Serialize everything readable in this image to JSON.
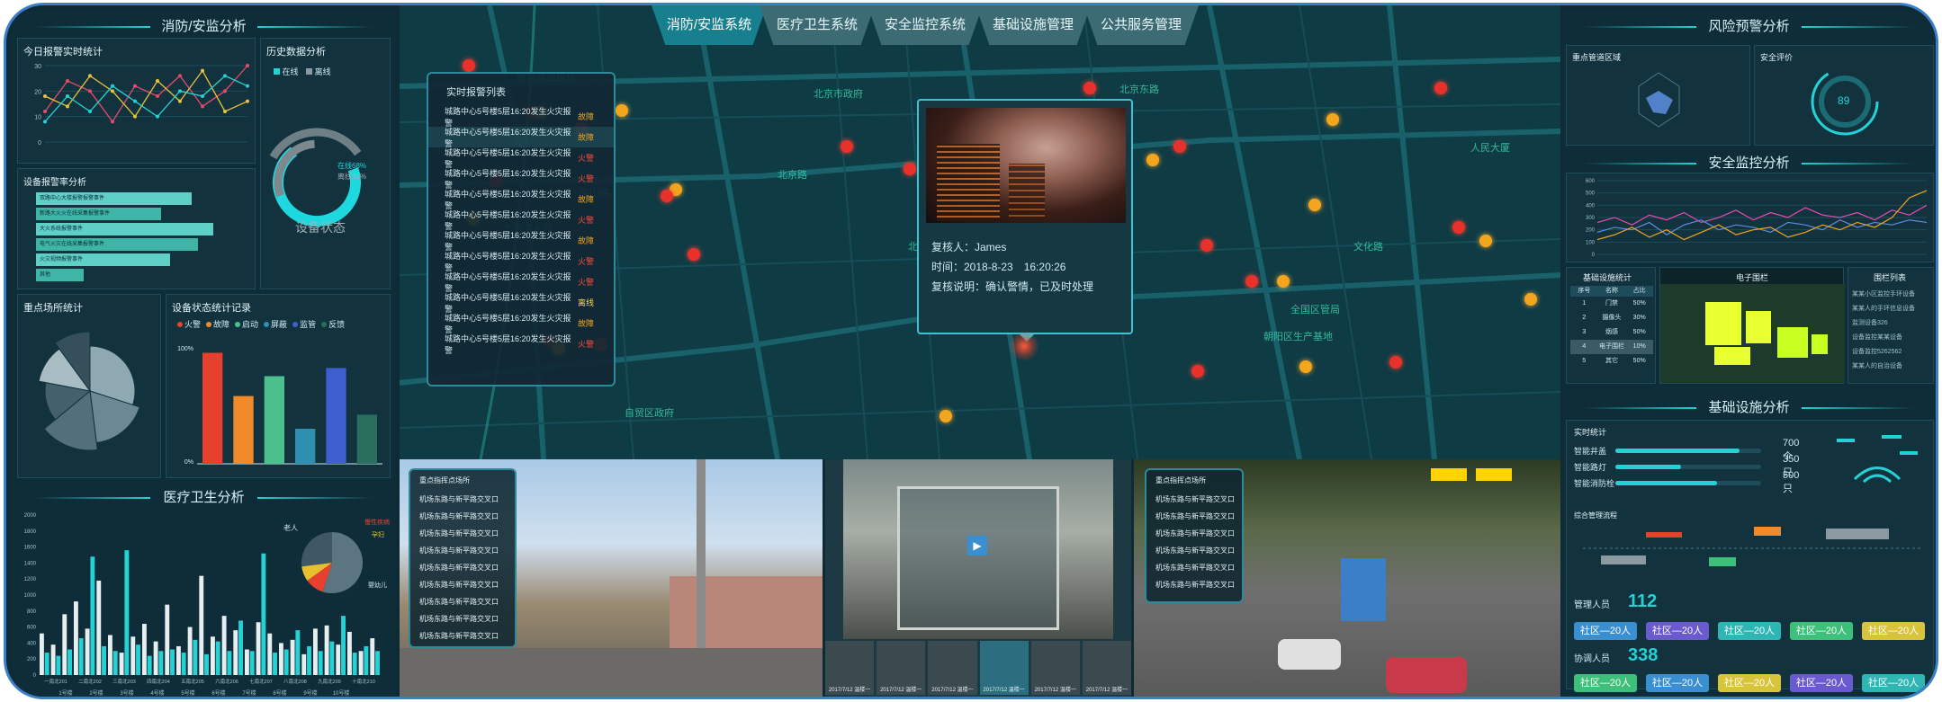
{
  "top_tabs": [
    "消防/安监系统",
    "医疗卫生系统",
    "安全监控系统",
    "基础设施管理",
    "公共服务管理"
  ],
  "left": {
    "section_title": "消防/安监分析",
    "today_alarm": {
      "title": "今日报警实时统计",
      "yticks": [
        "30",
        "20",
        "10",
        "0"
      ]
    },
    "history": {
      "title": "历史数据分析",
      "legend": [
        "在线",
        "离线"
      ],
      "online": "在线68%",
      "offline": "离线32%",
      "center": "设备状态",
      "online_pct": 68
    },
    "alarm_rate": {
      "title": "设备报警率分析",
      "bars": [
        {
          "label": "双路中心大楼报警报警事件",
          "v": 0.72
        },
        {
          "label": "新路大火火在线采集报警事件",
          "v": 0.58
        },
        {
          "label": "大火系统报警事件",
          "v": 0.82
        },
        {
          "label": "电气火灾在线采集报警事件",
          "v": 0.75
        },
        {
          "label": "火灾视频报警事件",
          "v": 0.62
        },
        {
          "label": "其他",
          "v": 0.22
        }
      ]
    },
    "area": {
      "title": "重点场所统计"
    },
    "device_status": {
      "title": "设备状态统计记录",
      "legend": [
        "火警",
        "故障",
        "启动",
        "屏蔽",
        "监管",
        "反馈"
      ],
      "colors": [
        "#e8402f",
        "#f08a2b",
        "#4bbf8e",
        "#2e8fb0",
        "#3f5fd0",
        "#2a6e5d"
      ],
      "values": [
        95,
        58,
        75,
        30,
        82,
        42
      ],
      "yticks": [
        "100%",
        "0%"
      ]
    }
  },
  "medical": {
    "title": "医疗卫生分析",
    "yticks": [
      "2000",
      "1800",
      "1600",
      "1400",
      "1200",
      "1000",
      "800",
      "600",
      "400",
      "200",
      "0"
    ],
    "xlabels": [
      "一南北201",
      "二南北202",
      "三南北203",
      "四南北204",
      "五南北205",
      "六南北206",
      "七南北207",
      "八南北208",
      "九南北209",
      "十南北210"
    ],
    "months": [
      "1号楼",
      "2号楼",
      "3号楼",
      "4号楼",
      "5号楼",
      "6号楼",
      "7号楼",
      "8号楼",
      "9号楼",
      "10号楼"
    ],
    "pie_labels": [
      "老人",
      "慢性疾病",
      "孕妇",
      "婴幼儿"
    ]
  },
  "alarm_list": {
    "title": "实时报警列表",
    "rows": [
      {
        "text": "城路中心5号楼5层16:20发生火灾报警",
        "status": "故障"
      },
      {
        "text": "城路中心5号楼5层16:20发生火灾报警",
        "status": "故障"
      },
      {
        "text": "城路中心5号楼5层16:20发生火灾报警",
        "status": "火警"
      },
      {
        "text": "城路中心5号楼5层16:20发生火灾报警",
        "status": "火警"
      },
      {
        "text": "城路中心5号楼5层16:20发生火灾报警",
        "status": "故障"
      },
      {
        "text": "城路中心5号楼5层16:20发生火灾报警",
        "status": "火警"
      },
      {
        "text": "城路中心5号楼5层16:20发生火灾报警",
        "status": "故障"
      },
      {
        "text": "城路中心5号楼5层16:20发生火灾报警",
        "status": "火警"
      },
      {
        "text": "城路中心5号楼5层16:20发生火灾报警",
        "status": "火警"
      },
      {
        "text": "城路中心5号楼5层16:20发生火灾报警",
        "status": "离线"
      },
      {
        "text": "城路中心5号楼5层16:20发生火灾报警",
        "status": "故障"
      },
      {
        "text": "城路中心5号楼5层16:20发生火灾报警",
        "status": "火警"
      }
    ]
  },
  "popup": {
    "reviewer": "复核人：James",
    "time": "时间：2018-8-23　16:20:26",
    "note": "复核说明：确认警情，已及时处理"
  },
  "map_labels": [
    "南京路正纵场",
    "北京市政府",
    "中山路",
    "北京工业园",
    "北京工厂",
    "北京东路",
    "朝阳区生产基地",
    "全国区管局",
    "自贸区政府",
    "人民大厦",
    "文化路",
    "北京路"
  ],
  "cam": {
    "list_title": "重点指挥点场所",
    "rows": [
      "机场东路与新平路交叉口",
      "机场东路与新平路交叉口",
      "机场东路与新平路交叉口",
      "机场东路与新平路交叉口",
      "机场东路与新平路交叉口",
      "机场东路与新平路交叉口",
      "机场东路与新平路交叉口",
      "机场东路与新平路交叉口",
      "机场东路与新平路交叉口"
    ],
    "list_title2": "重点指挥点场所",
    "rows2": [
      "机场东路与新平路交叉口",
      "机场东路与新平路交叉口",
      "机场东路与新平路交叉口",
      "机场东路与新平路交叉口",
      "机场东路与新平路交叉口",
      "机场东路与新平路交叉口"
    ],
    "thumbs": [
      "2017/7/12 温楼一",
      "2017/7/12 温楼一",
      "2017/7/12 温楼一",
      "2017/7/12 温楼一",
      "2017/7/12 温楼一",
      "2017/7/12 温楼一"
    ]
  },
  "right": {
    "risk_title": "风险预警分析",
    "area_title": "重点管道区域",
    "safety_title": "安全评价",
    "safety_value": "89",
    "monitor_title": "安全监控分析",
    "monitor_yticks": [
      "600",
      "500",
      "400",
      "300",
      "200",
      "100",
      "0"
    ],
    "infra_stat": {
      "title": "基础设施统计",
      "headers": [
        "序号",
        "名称",
        "占比"
      ],
      "rows": [
        [
          "1",
          "门禁",
          "50%"
        ],
        [
          "2",
          "摄像头",
          "30%"
        ],
        [
          "3",
          "烟感",
          "50%"
        ],
        [
          "4",
          "电子围栏",
          "10%"
        ],
        [
          "5",
          "其它",
          "50%"
        ]
      ]
    },
    "fence_title": "电子围栏",
    "list_title": "围栏列表",
    "fence_items": [
      "某某小区监控手环设备",
      "某某人的手环信息设备",
      "监测设备326",
      "设备监控某某设备",
      "设备监控5262562",
      "某某人的自治设备"
    ],
    "infra_title": "基础设施分析",
    "realtime": {
      "title": "实时统计",
      "items": [
        {
          "label": "智能井盖",
          "value": "700个",
          "pct": 0.85
        },
        {
          "label": "智能路灯",
          "value": "350只",
          "pct": 0.45
        },
        {
          "label": "智能消防栓",
          "value": "500只",
          "pct": 0.7
        }
      ]
    },
    "mgmt_title": "综合管理流程",
    "managers": {
      "label": "管理人员",
      "count": "112",
      "buttons": [
        "社区—20人",
        "社区—20人",
        "社区—20人",
        "社区—20人",
        "社区—20人"
      ]
    },
    "coord": {
      "label": "协调人员",
      "count": "338",
      "buttons": [
        "社区—20人",
        "社区—20人",
        "社区—20人",
        "社区—20人",
        "社区—20人"
      ]
    },
    "btn_colors": [
      "#3a8fd0",
      "#6a5ad0",
      "#2eb6b4",
      "#3cc07a",
      "#d8c43a"
    ],
    "btn_colors2": [
      "#3cc07a",
      "#3a8fd0",
      "#d8c43a",
      "#6a5ad0",
      "#2eb6b4"
    ]
  },
  "chart_data": [
    {
      "type": "line",
      "title": "今日报警实时统计",
      "series": [
        {
          "values": [
            12,
            24,
            20,
            8,
            22,
            18,
            26,
            14,
            20,
            30
          ]
        },
        {
          "values": [
            18,
            14,
            26,
            20,
            10,
            24,
            16,
            28,
            12,
            16
          ]
        },
        {
          "values": [
            8,
            18,
            12,
            22,
            16,
            10,
            20,
            18,
            26,
            22
          ]
        }
      ],
      "ylim": [
        0,
        30
      ]
    },
    {
      "type": "bar",
      "title": "设备状态统计记录",
      "categories": [
        "火警",
        "故障",
        "启动",
        "屏蔽",
        "监管",
        "反馈"
      ],
      "values": [
        95,
        58,
        75,
        30,
        82,
        42
      ],
      "ylim": [
        0,
        100
      ]
    },
    {
      "type": "bar",
      "title": "医疗卫生分析",
      "series": [
        {
          "values": [
            520,
            380,
            760,
            920,
            580,
            1180,
            500,
            280,
            480,
            640,
            420,
            880,
            360,
            600,
            1240,
            480,
            740,
            560,
            320,
            660,
            520,
            400,
            440,
            260,
            580,
            620,
            380,
            540,
            300,
            460
          ]
        },
        {
          "values": [
            280,
            240,
            320,
            460,
            1480,
            360,
            300,
            1560,
            380,
            240,
            300,
            320,
            280,
            440,
            260,
            420,
            300,
            680,
            300,
            1520,
            280,
            320,
            560,
            360,
            300,
            420,
            740,
            280,
            360,
            300
          ]
        }
      ],
      "ylim": [
        0,
        2000
      ]
    },
    {
      "type": "pie",
      "title": "重点场所统计",
      "values": [
        30,
        18,
        16,
        14,
        12,
        10
      ]
    },
    {
      "type": "line",
      "title": "安全监控分析",
      "series": [
        {
          "values": [
            260,
            300,
            240,
            320,
            280,
            340,
            260,
            300,
            360,
            280,
            340,
            300,
            380,
            320,
            300,
            340,
            280,
            360,
            320,
            400
          ]
        },
        {
          "values": [
            180,
            220,
            200,
            260,
            160,
            240,
            280,
            200,
            240,
            220,
            180,
            260,
            240,
            200,
            280,
            220,
            260,
            240,
            280,
            260
          ]
        },
        {
          "values": [
            120,
            160,
            220,
            140,
            200,
            120,
            180,
            240,
            160,
            200,
            220,
            140,
            180,
            240,
            200,
            260,
            220,
            300,
            460,
            520
          ]
        }
      ],
      "ylim": [
        0,
        600
      ]
    }
  ]
}
